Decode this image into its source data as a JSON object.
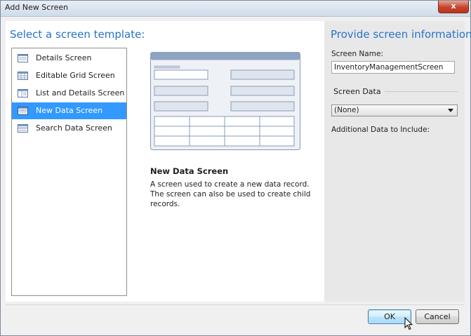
{
  "window": {
    "title": "Add New Screen",
    "close_label": "x"
  },
  "templates": {
    "heading": "Select a screen template:",
    "items": [
      {
        "label": "Details Screen",
        "icon": "details-screen-icon",
        "selected": false
      },
      {
        "label": "Editable Grid Screen",
        "icon": "editable-grid-icon",
        "selected": false
      },
      {
        "label": "List and Details Screen",
        "icon": "list-details-icon",
        "selected": false
      },
      {
        "label": "New Data Screen",
        "icon": "new-data-icon",
        "selected": true
      },
      {
        "label": "Search Data Screen",
        "icon": "search-data-icon",
        "selected": false
      }
    ]
  },
  "preview": {
    "title": "New Data Screen",
    "description": "A screen used to create a new data record.  The screen can also be used to create child records."
  },
  "info": {
    "heading": "Provide screen information:",
    "screen_name_label": "Screen Name:",
    "screen_name_value": "InventoryManagementScreen",
    "screen_data_label": "Screen Data",
    "screen_data_value": "(None)",
    "additional_label": "Additional Data to Include:"
  },
  "buttons": {
    "ok": "OK",
    "cancel": "Cancel"
  },
  "colors": {
    "accent": "#2a72c8",
    "selection": "#3399ff",
    "panel": "#e8e8e8"
  }
}
